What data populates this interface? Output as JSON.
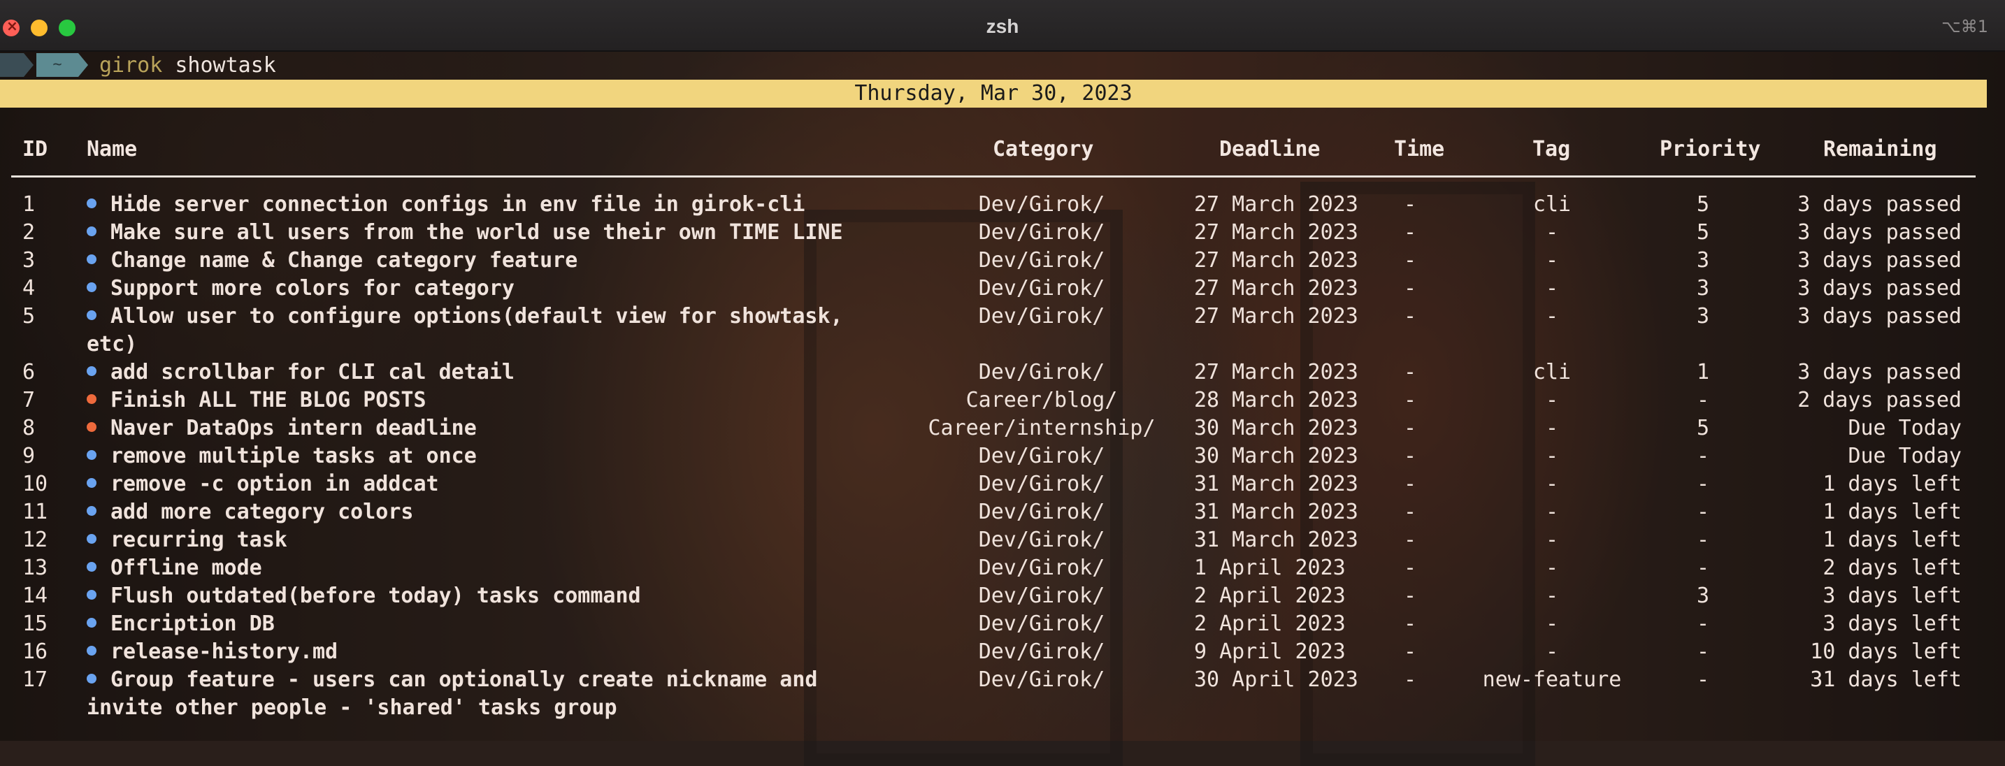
{
  "window": {
    "title": "zsh",
    "shortcut": "⌥⌘1"
  },
  "prompt": {
    "dir": "~",
    "command": "girok",
    "argument": "showtask"
  },
  "date_banner": "Thursday, Mar 30, 2023",
  "colors": {
    "date_banner_bg": "#f1d57e",
    "dot_blue": "#6aa3f0",
    "dot_orange": "#ee6a3c"
  },
  "table": {
    "headers": {
      "id": "ID",
      "name": "Name",
      "category": "Category",
      "deadline": "Deadline",
      "time": "Time",
      "tag": "Tag",
      "priority": "Priority",
      "remaining": "Remaining"
    },
    "rows": [
      {
        "id": "1",
        "name": "Hide server connection configs in env file in girok-cli",
        "category": "Dev/Girok/",
        "deadline": "27 March 2023",
        "time": "-",
        "tag": "cli",
        "priority": "5",
        "remaining": "3 days passed",
        "dot": "blue"
      },
      {
        "id": "2",
        "name": "Make sure all users from the world use their own TIME LINE",
        "category": "Dev/Girok/",
        "deadline": "27 March 2023",
        "time": "-",
        "tag": "-",
        "priority": "5",
        "remaining": "3 days passed",
        "dot": "blue"
      },
      {
        "id": "3",
        "name": "Change name & Change category feature",
        "category": "Dev/Girok/",
        "deadline": "27 March 2023",
        "time": "-",
        "tag": "-",
        "priority": "3",
        "remaining": "3 days passed",
        "dot": "blue"
      },
      {
        "id": "4",
        "name": "Support more colors for category",
        "category": "Dev/Girok/",
        "deadline": "27 March 2023",
        "time": "-",
        "tag": "-",
        "priority": "3",
        "remaining": "3 days passed",
        "dot": "blue"
      },
      {
        "id": "5",
        "name": "Allow user to configure options(default view for showtask, etc)",
        "category": "Dev/Girok/",
        "deadline": "27 March 2023",
        "time": "-",
        "tag": "-",
        "priority": "3",
        "remaining": "3 days passed",
        "dot": "blue"
      },
      {
        "id": "6",
        "name": "add scrollbar for CLI cal detail",
        "category": "Dev/Girok/",
        "deadline": "27 March 2023",
        "time": "-",
        "tag": "cli",
        "priority": "1",
        "remaining": "3 days passed",
        "dot": "blue"
      },
      {
        "id": "7",
        "name": "Finish ALL THE BLOG POSTS",
        "category": "Career/blog/",
        "deadline": "28 March 2023",
        "time": "-",
        "tag": "-",
        "priority": "-",
        "remaining": "2 days passed",
        "dot": "orange"
      },
      {
        "id": "8",
        "name": "Naver DataOps intern deadline",
        "category": "Career/internship/",
        "deadline": "30 March 2023",
        "time": "-",
        "tag": "-",
        "priority": "5",
        "remaining": "Due Today",
        "dot": "orange"
      },
      {
        "id": "9",
        "name": "remove multiple tasks at once",
        "category": "Dev/Girok/",
        "deadline": "30 March 2023",
        "time": "-",
        "tag": "-",
        "priority": "-",
        "remaining": "Due Today",
        "dot": "blue"
      },
      {
        "id": "10",
        "name": "remove -c option in addcat",
        "category": "Dev/Girok/",
        "deadline": "31 March 2023",
        "time": "-",
        "tag": "-",
        "priority": "-",
        "remaining": "1 days left",
        "dot": "blue"
      },
      {
        "id": "11",
        "name": "add more category colors",
        "category": "Dev/Girok/",
        "deadline": "31 March 2023",
        "time": "-",
        "tag": "-",
        "priority": "-",
        "remaining": "1 days left",
        "dot": "blue"
      },
      {
        "id": "12",
        "name": "recurring task",
        "category": "Dev/Girok/",
        "deadline": "31 March 2023",
        "time": "-",
        "tag": "-",
        "priority": "-",
        "remaining": "1 days left",
        "dot": "blue"
      },
      {
        "id": "13",
        "name": "Offline mode",
        "category": "Dev/Girok/",
        "deadline": "1 April 2023",
        "time": "-",
        "tag": "-",
        "priority": "-",
        "remaining": "2 days left",
        "dot": "blue"
      },
      {
        "id": "14",
        "name": "Flush outdated(before today) tasks command",
        "category": "Dev/Girok/",
        "deadline": "2 April 2023",
        "time": "-",
        "tag": "-",
        "priority": "3",
        "remaining": "3 days left",
        "dot": "blue"
      },
      {
        "id": "15",
        "name": "Encription DB",
        "category": "Dev/Girok/",
        "deadline": "2 April 2023",
        "time": "-",
        "tag": "-",
        "priority": "-",
        "remaining": "3 days left",
        "dot": "blue"
      },
      {
        "id": "16",
        "name": "release-history.md",
        "category": "Dev/Girok/",
        "deadline": "9 April 2023",
        "time": "-",
        "tag": "-",
        "priority": "-",
        "remaining": "10 days left",
        "dot": "blue"
      },
      {
        "id": "17",
        "name": "Group feature - users can optionally create nickname and invite other people - 'shared' tasks group",
        "category": "Dev/Girok/",
        "deadline": "30 April 2023",
        "time": "-",
        "tag": "new-feature",
        "priority": "-",
        "remaining": "31 days left",
        "dot": "blue"
      }
    ]
  }
}
